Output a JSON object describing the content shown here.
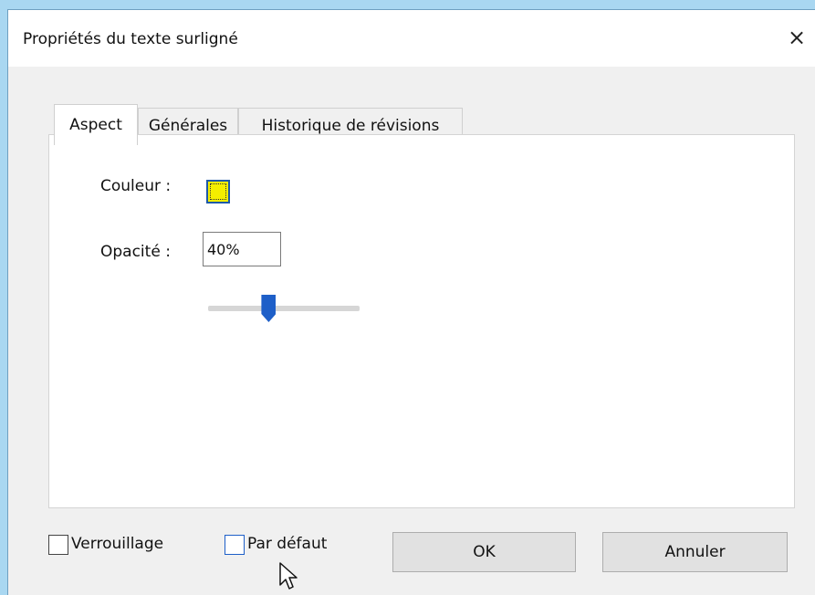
{
  "window": {
    "title": "Propriétés du texte surligné",
    "close_glyph": "×"
  },
  "tabs": [
    {
      "label": "Aspect",
      "active": true
    },
    {
      "label": "Générales",
      "active": false
    },
    {
      "label": "Historique de révisions",
      "active": false
    }
  ],
  "aspect": {
    "color_label": "Couleur :",
    "color_value": "#f4ee00",
    "opacity_label": "Opacité :",
    "opacity_value": "40%",
    "opacity_slider_fraction": 0.4
  },
  "footer": {
    "lock_label": "Verrouillage",
    "lock_checked": false,
    "default_label": "Par défaut",
    "default_checked": false,
    "ok_label": "OK",
    "cancel_label": "Annuler"
  },
  "icons": {
    "close": "close-icon",
    "cursor": "mouse-pointer-icon"
  }
}
